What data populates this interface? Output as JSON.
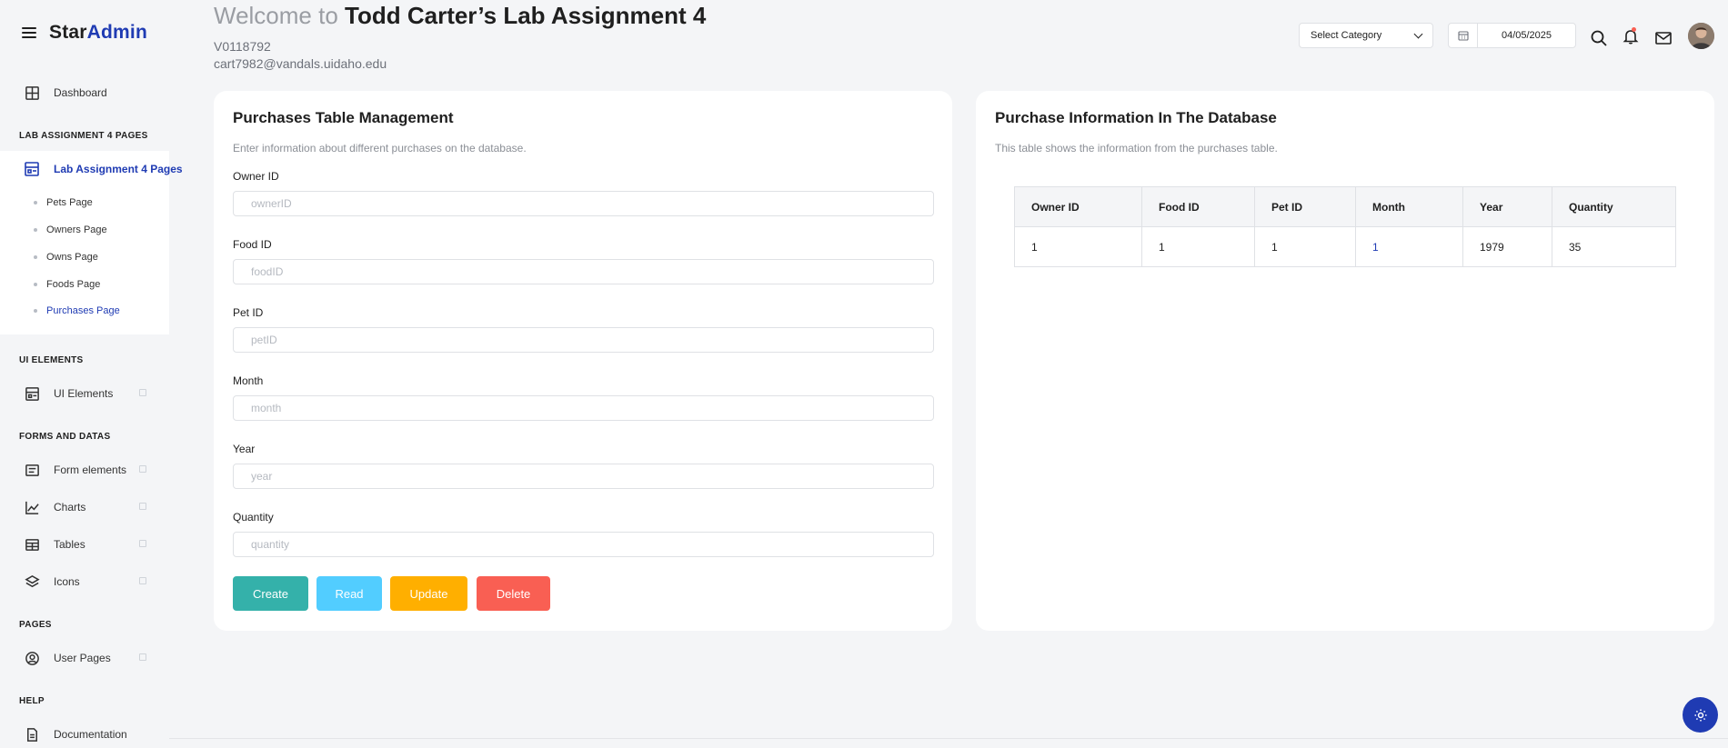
{
  "brand": {
    "part1": "Star",
    "part2": "Admin"
  },
  "sidebar": {
    "dashboard": "Dashboard",
    "sections": {
      "lab": "LAB ASSIGNMENT 4 PAGES",
      "ui": "UI ELEMENTS",
      "forms": "FORMS AND DATAS",
      "pages": "PAGES",
      "help": "HELP"
    },
    "lab_item": "Lab Assignment 4 Pages",
    "sub_items": [
      "Pets Page",
      "Owners Page",
      "Owns Page",
      "Foods Page",
      "Purchases Page"
    ],
    "ui_elements": "UI Elements",
    "form_elements": "Form elements",
    "charts": "Charts",
    "tables": "Tables",
    "icons": "Icons",
    "user_pages": "User Pages",
    "documentation": "Documentation"
  },
  "header": {
    "welcome_prefix": "Welcome to ",
    "welcome_name": "Todd Carter’s Lab Assignment 4",
    "student_id": "V0118792",
    "email": "cart7982@vandals.uidaho.edu",
    "select_category": "Select Category",
    "date": "04/05/2025"
  },
  "form_card": {
    "title": "Purchases Table Management",
    "description": "Enter information about different purchases on the database.",
    "fields": [
      {
        "label": "Owner ID",
        "placeholder": "ownerID"
      },
      {
        "label": "Food ID",
        "placeholder": "foodID"
      },
      {
        "label": "Pet ID",
        "placeholder": "petID"
      },
      {
        "label": "Month",
        "placeholder": "month"
      },
      {
        "label": "Year",
        "placeholder": "year"
      },
      {
        "label": "Quantity",
        "placeholder": "quantity"
      }
    ],
    "buttons": {
      "create": "Create",
      "read": "Read",
      "update": "Update",
      "delete": "Delete"
    }
  },
  "table_card": {
    "title": "Purchase Information In The Database",
    "description": "This table shows the information from the purchases table.",
    "columns": [
      "Owner ID",
      "Food ID",
      "Pet ID",
      "Month",
      "Year",
      "Quantity"
    ],
    "rows": [
      [
        "1",
        "1",
        "1",
        "1",
        "1979",
        "35"
      ]
    ]
  },
  "colors": {
    "accent": "#1f3bb3",
    "create": "#34b1aa",
    "read": "#52cdff",
    "update": "#ffaf00",
    "delete": "#f95f53"
  }
}
